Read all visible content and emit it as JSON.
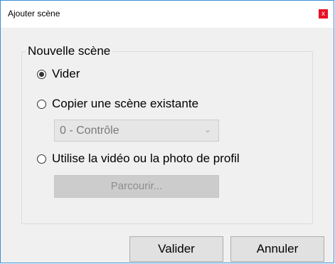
{
  "window": {
    "title": "Ajouter scène",
    "close_label": "x"
  },
  "group": {
    "legend": "Nouvelle scène"
  },
  "options": {
    "vider": {
      "label": "Vider",
      "checked": true
    },
    "copier": {
      "label": "Copier une scène existante",
      "checked": false
    },
    "utiliser": {
      "label": "Utilise la vidéo ou la photo de profil",
      "checked": false
    }
  },
  "scene_select": {
    "value": "0 - Contrôle",
    "arrow": "⌄",
    "disabled": true
  },
  "browse_button": {
    "label": "Parcourir...",
    "disabled": true
  },
  "buttons": {
    "ok": "Valider",
    "cancel": "Annuler"
  }
}
